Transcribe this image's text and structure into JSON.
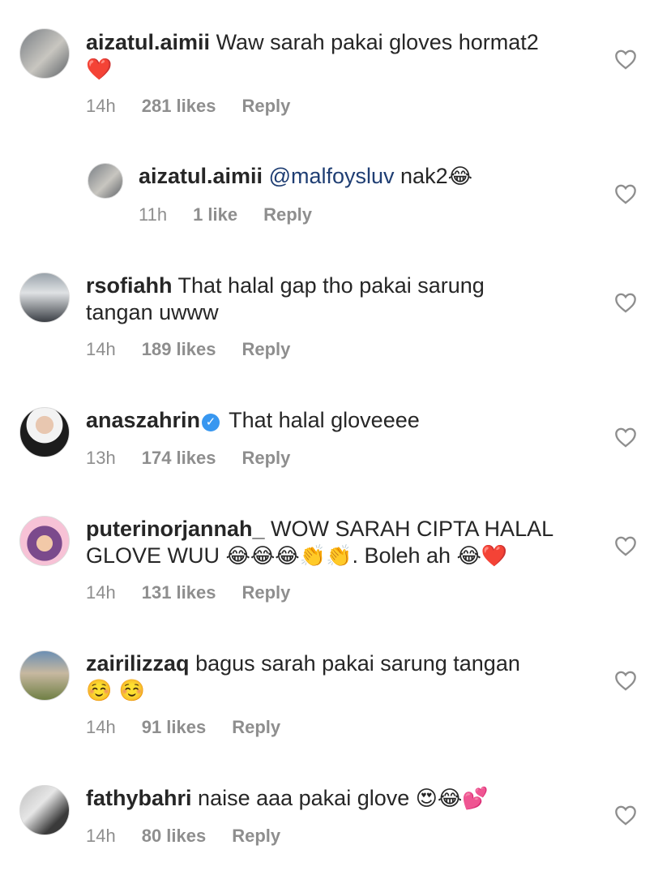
{
  "comments": [
    {
      "username": "aizatul.aimii",
      "text": "Waw sarah pakai gloves hormat2",
      "emoji": "❤️",
      "time": "14h",
      "likes": "281 likes",
      "reply": "Reply"
    },
    {
      "username": "aizatul.aimii",
      "mention": "@malfoysluv",
      "text": " nak2",
      "emoji": "😂",
      "time": "11h",
      "likes": "1 like",
      "reply": "Reply"
    },
    {
      "username": "rsofiahh",
      "text": "That halal gap tho pakai sarung tangan uwww",
      "time": "14h",
      "likes": "189 likes",
      "reply": "Reply"
    },
    {
      "username": "anaszahrin",
      "text": "That halal gloveeee",
      "time": "13h",
      "likes": "174 likes",
      "reply": "Reply"
    },
    {
      "username": "puterinorjannah_",
      "text": "WOW SARAH CIPTA HALAL GLOVE WUU",
      "emoji": "😂😂😂👏👏",
      "text2": ". Boleh  ah",
      "emoji2": "😂❤️",
      "time": "14h",
      "likes": "131 likes",
      "reply": "Reply"
    },
    {
      "username": "zairilizzaq",
      "text": "bagus sarah pakai sarung tangan",
      "emoji": "☺️ ☺️",
      "time": "14h",
      "likes": "91 likes",
      "reply": "Reply"
    },
    {
      "username": "fathybahri",
      "text": "naise aaa pakai glove",
      "emoji": "😍😂💕",
      "time": "14h",
      "likes": "80 likes",
      "reply": "Reply"
    }
  ],
  "icons": {
    "like": "heart-outline-icon",
    "verified": "verified-badge-icon"
  }
}
